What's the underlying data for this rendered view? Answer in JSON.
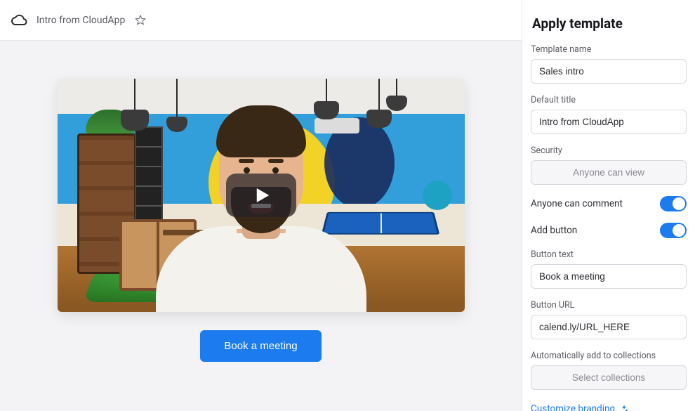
{
  "topbar": {
    "title": "Intro from CloudApp"
  },
  "preview": {
    "cta_label": "Book a meeting"
  },
  "sidebar": {
    "heading": "Apply template",
    "template_name_label": "Template name",
    "template_name_value": "Sales intro",
    "default_title_label": "Default title",
    "default_title_value": "Intro from CloudApp",
    "security_label": "Security",
    "security_value": "Anyone can view",
    "anyone_can_comment_label": "Anyone can comment",
    "anyone_can_comment_on": true,
    "add_button_label": "Add button",
    "add_button_on": true,
    "button_text_label": "Button text",
    "button_text_value": "Book a meeting",
    "button_url_label": "Button URL",
    "button_url_value": "calend.ly/URL_HERE",
    "collections_label": "Automatically add to collections",
    "collections_value": "Select collections",
    "customize_branding_label": "Customize branding"
  }
}
